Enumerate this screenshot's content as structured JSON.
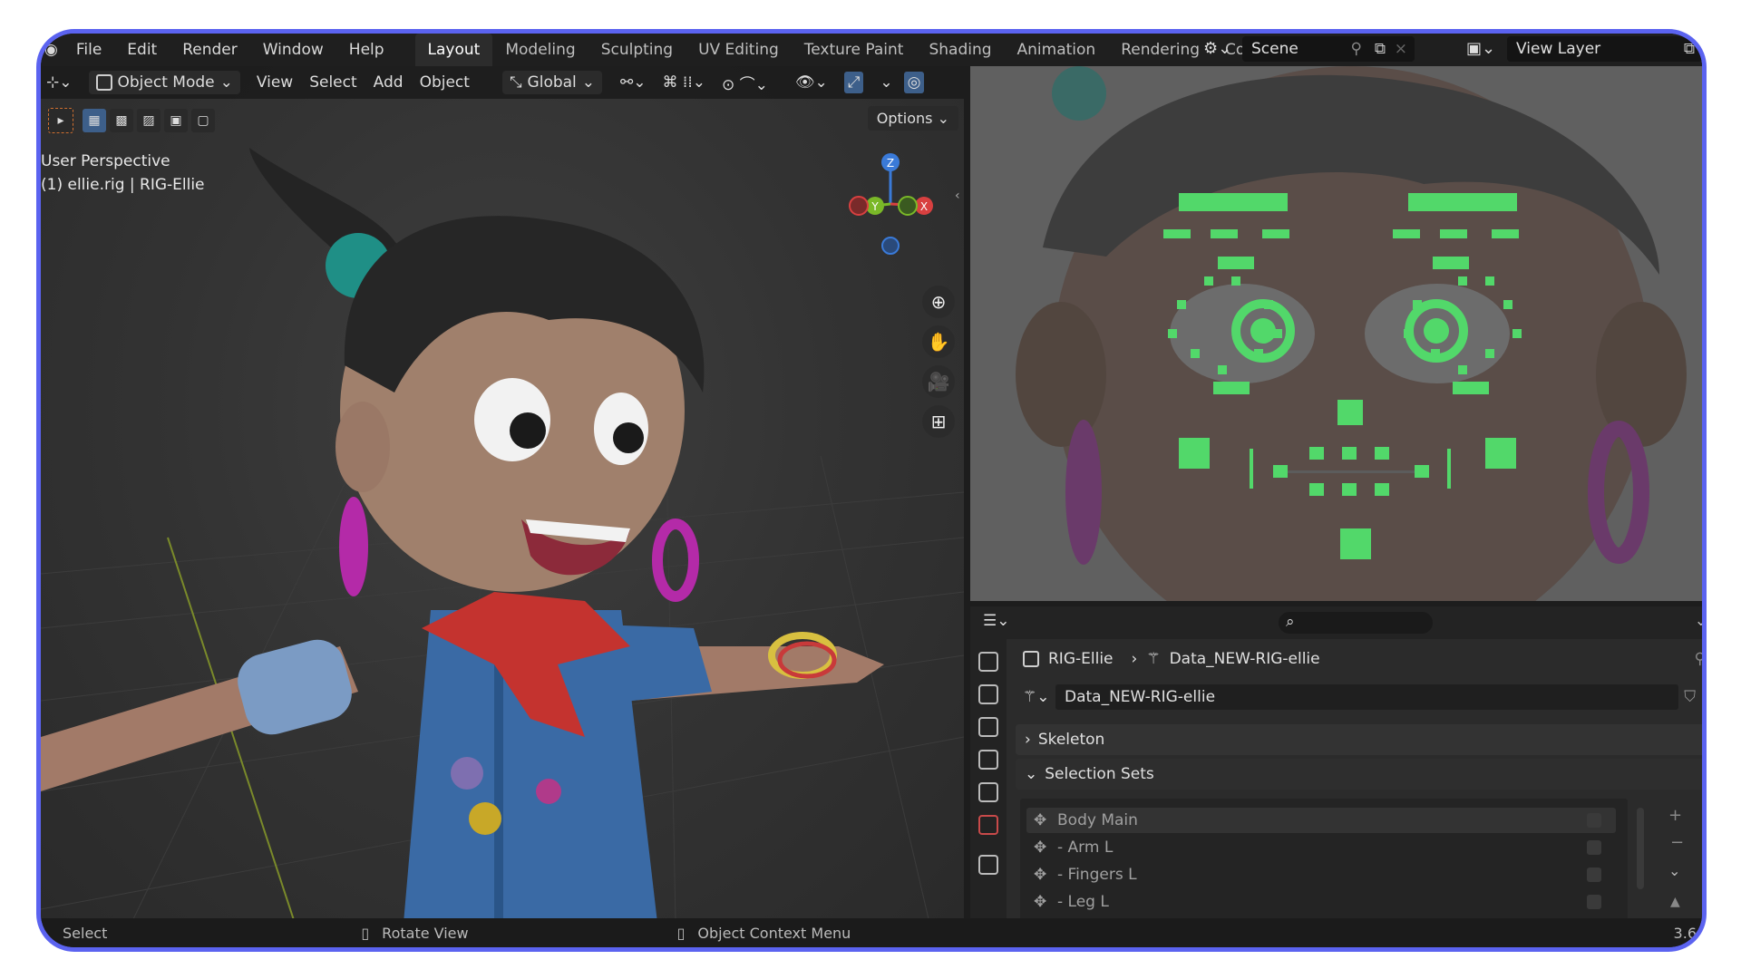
{
  "topbar": {
    "menu": [
      "File",
      "Edit",
      "Render",
      "Window",
      "Help"
    ],
    "workspaces": [
      "Layout",
      "Modeling",
      "Sculpting",
      "UV Editing",
      "Texture Paint",
      "Shading",
      "Animation",
      "Rendering",
      "Comp"
    ],
    "active_workspace": "Layout",
    "scene": "Scene",
    "view_layer": "View Layer"
  },
  "viewport": {
    "mode": "Object Mode",
    "menu": [
      "View",
      "Select",
      "Add",
      "Object"
    ],
    "transform_orientation": "Global",
    "options_label": "Options",
    "perspective_label": "User Perspective",
    "object_label": "(1) ellie.rig | RIG-Ellie",
    "gizmo_axes": {
      "z": "Z",
      "y": "Y",
      "x": "X"
    }
  },
  "properties": {
    "breadcrumb": {
      "object": "RIG-Ellie",
      "data": "Data_NEW-RIG-ellie"
    },
    "data_name": "Data_NEW-RIG-ellie",
    "panels": {
      "skeleton": "Skeleton",
      "selection_sets": "Selection Sets"
    },
    "selection_sets": [
      "Body Main",
      "- Arm L",
      "- Fingers L",
      "- Leg L"
    ]
  },
  "statusbar": {
    "select": "Select",
    "rotate": "Rotate View",
    "context": "Object Context Menu",
    "version": "3.6"
  },
  "colors": {
    "frame_border": "#5b63f0",
    "rig_green": "#52d86a",
    "active_blue": "#3d5f8a"
  }
}
